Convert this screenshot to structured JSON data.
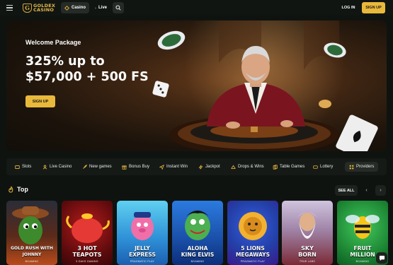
{
  "header": {
    "logo_line1": "GOLDEX",
    "logo_line2": "CASINO",
    "tabs": [
      {
        "label": "Casino",
        "active": true
      },
      {
        "label": "Live",
        "active": false
      }
    ],
    "login_label": "LOG IN",
    "signup_label": "SIGN UP"
  },
  "hero": {
    "subtitle": "Welcome Package",
    "title_line1": "325% up to",
    "title_line2": "$57,000 + 500 FS",
    "button_label": "SIGN UP"
  },
  "categories": [
    {
      "label": "Slots",
      "icon": "slots-icon"
    },
    {
      "label": "Live Casino",
      "icon": "dealer-icon"
    },
    {
      "label": "New games",
      "icon": "rocket-icon"
    },
    {
      "label": "Bonus Buy",
      "icon": "gift-icon"
    },
    {
      "label": "Instant Win",
      "icon": "plane-icon"
    },
    {
      "label": "Jackpot",
      "icon": "lightning-icon"
    },
    {
      "label": "Drops & Wins",
      "icon": "drops-icon"
    },
    {
      "label": "Table Games",
      "icon": "cards-icon"
    },
    {
      "label": "Lottery",
      "icon": "ticket-icon"
    },
    {
      "label": "Providers",
      "icon": "grid-icon"
    }
  ],
  "top_section": {
    "title": "Top",
    "see_all_label": "SEE ALL"
  },
  "games": [
    {
      "title": "GOLD RUSH WITH\nJOHNNY",
      "provider": "BGAMING",
      "bg": [
        "#2a2d38",
        "#b94b1b"
      ]
    },
    {
      "title": "3 HOT\nTEAPOTS",
      "provider": "3 OAKS GAMING",
      "bg": [
        "#4a0a0c",
        "#8f1616"
      ]
    },
    {
      "title": "JELLY\nEXPRESS",
      "provider": "PRAGMATIC PLAY",
      "bg": [
        "#4fc3e8",
        "#1c78c9"
      ]
    },
    {
      "title": "ALOHA\nKING ELVIS",
      "provider": "BGAMING",
      "bg": [
        "#1a5fc4",
        "#0b2f7a"
      ]
    },
    {
      "title": "5 LIONS\nMEGAWAYS",
      "provider": "PRAGMATIC PLAY",
      "bg": [
        "#2443b8",
        "#3a1a8c"
      ]
    },
    {
      "title": "SKY\nBORN",
      "provider": "TRUE LABS",
      "bg": [
        "#c7b9d8",
        "#7b2a36"
      ]
    },
    {
      "title": "FRUIT\nMILLION",
      "provider": "BGAMING",
      "bg": [
        "#2cb34a",
        "#0d5c22"
      ]
    }
  ],
  "colors": {
    "accent": "#e9b93b",
    "background": "#0f1310",
    "panel": "#161a17"
  }
}
